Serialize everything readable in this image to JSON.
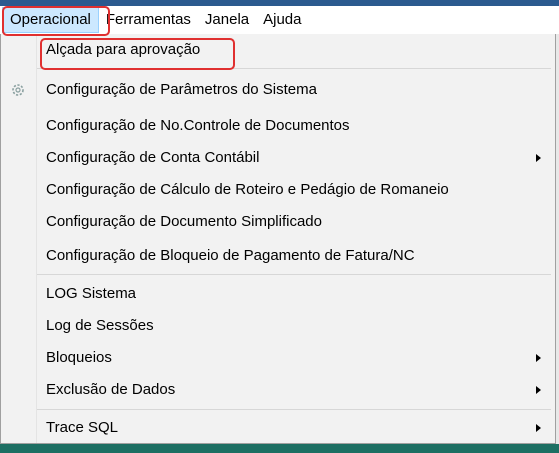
{
  "menubar": {
    "items": [
      {
        "label": "Operacional"
      },
      {
        "label": "Ferramentas"
      },
      {
        "label": "Janela"
      },
      {
        "label": "Ajuda"
      }
    ]
  },
  "dropdown": {
    "items": [
      {
        "label": "Alçada para aprovação"
      },
      {
        "label": "Configuração de Parâmetros do Sistema",
        "icon": "gear-icon"
      },
      {
        "label": "Configuração de No.Controle de Documentos"
      },
      {
        "label": "Configuração de Conta Contábil",
        "submenu": true
      },
      {
        "label": "Configuração de Cálculo de Roteiro e Pedágio de Romaneio"
      },
      {
        "label": "Configuração de Documento Simplificado"
      },
      {
        "label": "Configuração de Bloqueio de Pagamento de Fatura/NC"
      },
      {
        "label": "LOG Sistema"
      },
      {
        "label": "Log de Sessões"
      },
      {
        "label": "Bloqueios",
        "submenu": true
      },
      {
        "label": "Exclusão de Dados",
        "submenu": true
      },
      {
        "label": "Trace SQL",
        "submenu": true
      }
    ]
  },
  "colors": {
    "highlight": "#e03030",
    "active_menu": "#cce8ff",
    "menu_background": "#f2f2f2"
  }
}
